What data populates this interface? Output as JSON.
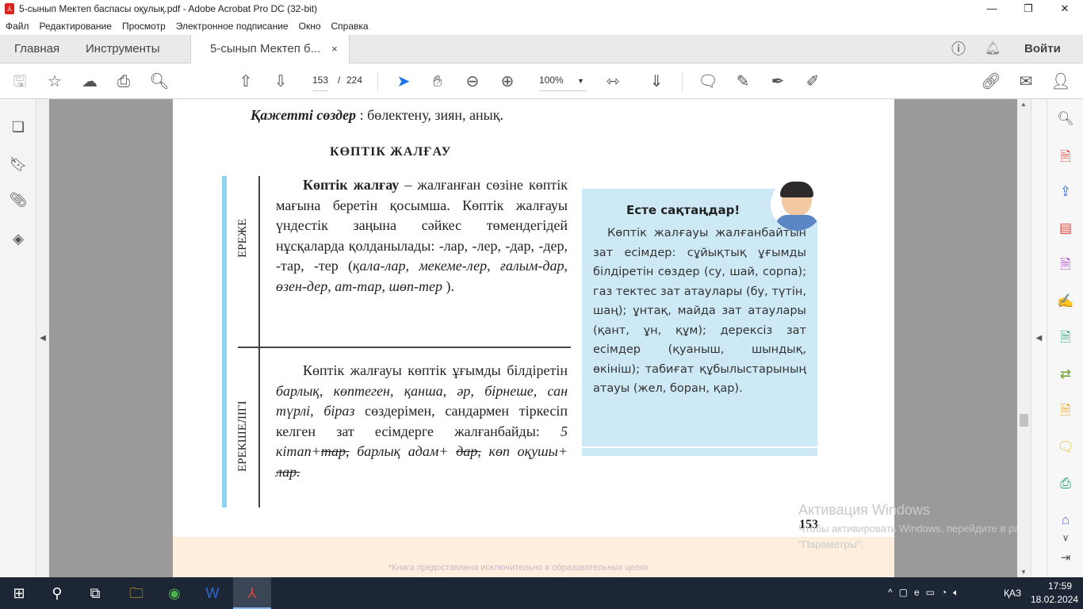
{
  "window": {
    "title": "5-сынып Мектеп баспасы оқулық.pdf - Adobe Acrobat Pro DC (32-bit)",
    "pdf_icon": "pdf-icon"
  },
  "menu": [
    "Файл",
    "Редактирование",
    "Просмотр",
    "Электронное подписание",
    "Окно",
    "Справка"
  ],
  "tabs": {
    "home": "Главная",
    "tools": "Инструменты",
    "document": "5-сынып Мектеп б...",
    "close": "×",
    "signin": "Войти"
  },
  "toolbar": {
    "page_current": "153",
    "page_sep": "/",
    "page_total": "224",
    "zoom": "100%"
  },
  "page": {
    "needed_label": "Қажетті сөздер",
    "needed_words": ": бөлектену,   зиян,   анық.",
    "heading": "КӨПТІК  ЖАЛҒАУ",
    "rule_side": "ЕРЕЖЕ",
    "rule_term": "Көптік жалғау",
    "rule_text": " – жалғанған сөзіне көптік мағына беретін қосымша. Көптік жалғауы үндестік заңына сәйкес төмендегідей нұсқаларда қолданылады: -лар, -лер, -дар, -дер, -тар, -тер (",
    "rule_examples": "қала-лар, мекеме-лер, ғалым-дар, өзен-дер, ат-тар, шөп-тер",
    "rule_end": " ).",
    "feature_side": "ЕРЕКШЕЛІГІ",
    "feature_text": "Көптік жалғауы көптік ұғымды білдіретін ",
    "feature_words": "барлық, көптеген, қанша, әр, бірнеше, сан түрлі, біраз",
    "feature_text2": " сөздерімен, сандармен тіркесіп келген зат есімдерге жалғанбайды: ",
    "feature_ex1": "5 кітап+",
    "feature_ex1s": "тар,",
    "feature_ex2": " барлық адам+ ",
    "feature_ex2s": "дар,",
    "feature_ex3": " көп оқушы+ ",
    "feature_ex3s": "лар.",
    "note_title": "Есте сақтаңдар!",
    "note_text": "Көптік жалғауы жалғанбайтын зат есімдер: сұйықтық ұғымды білдіретін сөздер (су, шай, сорпа); газ тектес зат атаулары (бу, түтін, шаң); ұнтақ, майда зат атаулары (қант, ұн, құм); дерексіз зат есімдер (қуаныш, шындық, өкініш); табиғат құбылыстарының атауы (жел, боран, қар).",
    "page_number": "153",
    "footer_note": "*Книга предоставлена исключительно в образовательных целях"
  },
  "watermark": {
    "title": "Активация Windows",
    "text": "Чтобы активировать Windows, перейдите в раздел \"Параметры\"."
  },
  "taskbar": {
    "lang": "ҚАЗ",
    "time": "17:59",
    "date": "18.02.2024"
  }
}
